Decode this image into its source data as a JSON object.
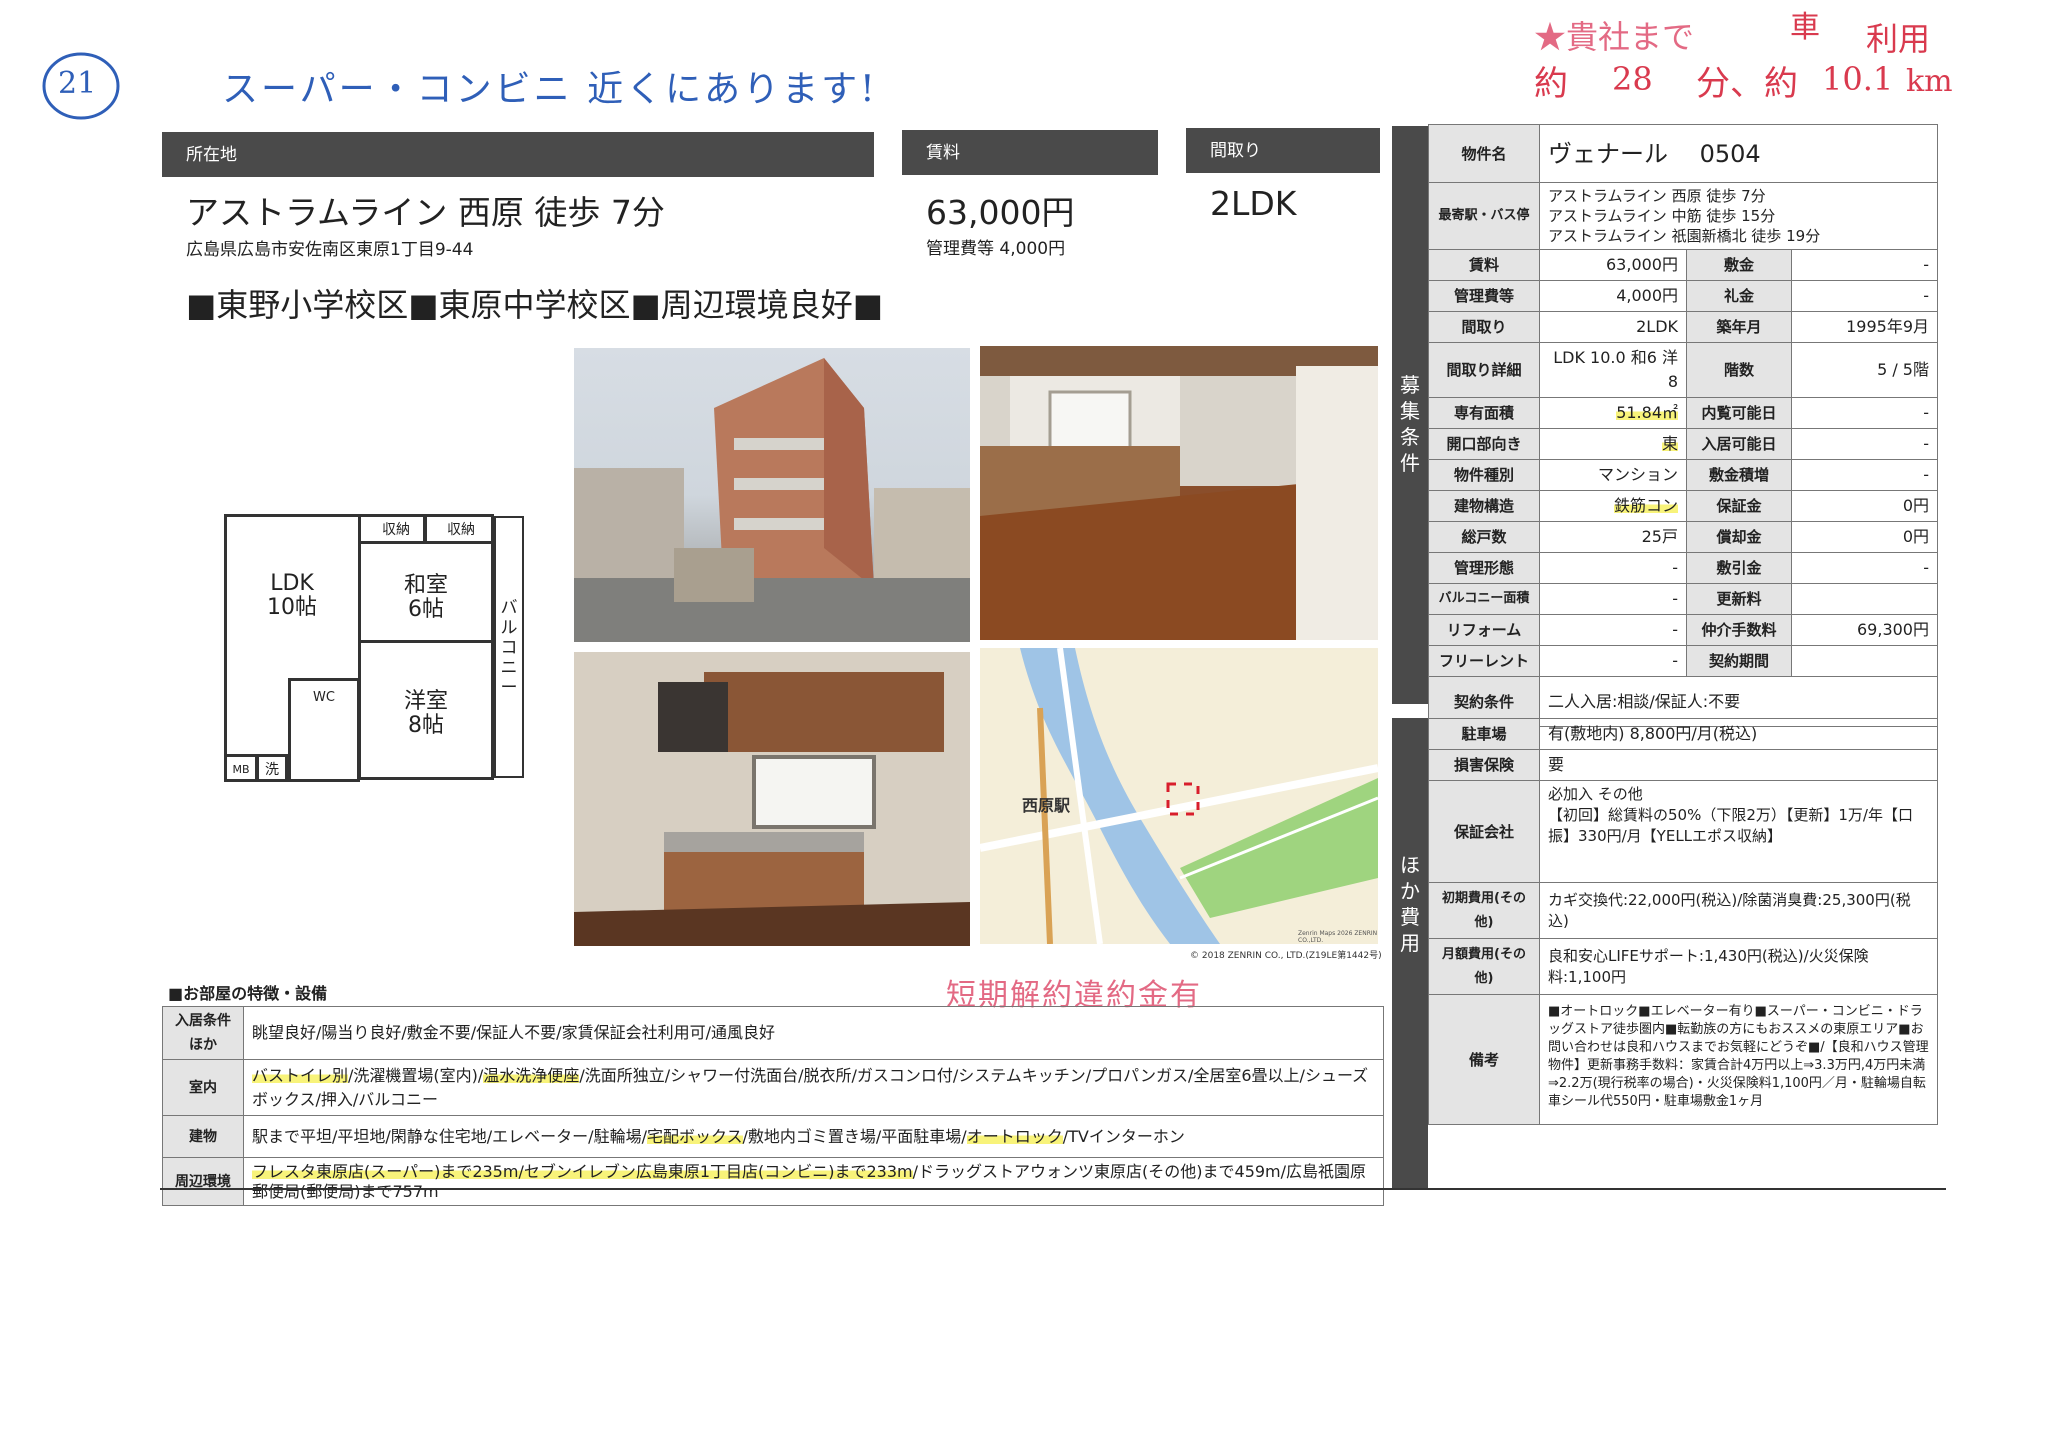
{
  "handwritten": {
    "circle_number": "21",
    "note": "スーパー・コンビニ 近くにあります!",
    "commute_line1_a": "★貴社まで",
    "commute_line1_b": "車",
    "commute_line1_c": "利用",
    "commute_approx1": "約",
    "commute_minutes": "28",
    "commute_min_unit": "分、約",
    "commute_km": "10.1",
    "commute_km_unit": "km",
    "penalty_stamp": "短期解約違約金有",
    "colors": {
      "blue": "#2f5fb8",
      "red": "#d93a4e",
      "pink": "#e36a84"
    }
  },
  "header": {
    "location_label": "所在地",
    "rent_label": "賃料",
    "layout_label": "間取り"
  },
  "summary": {
    "access": "アストラムライン 西原 徒歩 7分",
    "address": "広島県広島市安佐南区東原1丁目9-44",
    "rent": "63,000円",
    "mgmt": "管理費等 4,000円",
    "layout": "2LDK",
    "school": "■東野小学校区■東原中学校区■周辺環境良好■"
  },
  "floorplan": {
    "storage1": "収納",
    "storage2": "収納",
    "ldk": "LDK",
    "ldk_size": "10帖",
    "washitsu": "和室",
    "washitsu_size": "6帖",
    "youshitsu": "洋室",
    "youshitsu_size": "8帖",
    "balcony": "バルコニー",
    "wc": "WC",
    "mb": "MB",
    "wash": "洗"
  },
  "map": {
    "station": "西原駅",
    "copyright_small": "Zenrin Maps 2026 ZENRIN CO.,LTD.",
    "copyright": "© 2018 ZENRIN CO., LTD.(Z19LE第1442号)"
  },
  "recruit_label": "募集条件",
  "other_label": "ほか費用",
  "specs": {
    "name_label": "物件名",
    "name": "ヴェナール　 0504",
    "station_label": "最寄駅・バス停",
    "station1": "アストラムライン 西原 徒歩 7分",
    "station2": "アストラムライン 中筋 徒歩 15分",
    "station3": "アストラムライン 祇園新橋北 徒歩 19分",
    "rows": [
      {
        "l1": "賃料",
        "v1": "63,000円",
        "l2": "敷金",
        "v2": "-"
      },
      {
        "l1": "管理費等",
        "v1": "4,000円",
        "l2": "礼金",
        "v2": "-"
      },
      {
        "l1": "間取り",
        "v1": "2LDK",
        "l2": "築年月",
        "v2": "1995年9月"
      },
      {
        "l1": "間取り詳細",
        "v1": "LDK 10.0 和6 洋8",
        "l2": "階数",
        "v2": "5 / 5階"
      },
      {
        "l1": "専有面積",
        "v1": "51.84㎡",
        "l2": "内覧可能日",
        "v2": "-"
      },
      {
        "l1": "開口部向き",
        "v1": "東",
        "l2": "入居可能日",
        "v2": "-"
      },
      {
        "l1": "物件種別",
        "v1": "マンション",
        "l2": "敷金積増",
        "v2": "-"
      },
      {
        "l1": "建物構造",
        "v1": "鉄筋コン",
        "l2": "保証金",
        "v2": "0円"
      },
      {
        "l1": "総戸数",
        "v1": "25戸",
        "l2": "償却金",
        "v2": "0円"
      },
      {
        "l1": "管理形態",
        "v1": "-",
        "l2": "敷引金",
        "v2": "-"
      },
      {
        "l1": "バルコニー面積",
        "v1": "-",
        "l2": "更新料",
        "v2": ""
      },
      {
        "l1": "リフォーム",
        "v1": "-",
        "l2": "仲介手数料",
        "v2": "69,300円"
      },
      {
        "l1": "フリーレント",
        "v1": "-",
        "l2": "契約期間",
        "v2": ""
      }
    ],
    "contract_label": "契約条件",
    "contract": "二人入居:相談/保証人:不要"
  },
  "costs": {
    "parking_label": "駐車場",
    "parking": "有(敷地内) 8,800円/月(税込)",
    "insurance_label": "損害保険",
    "insurance": "要",
    "guarantor_label": "保証会社",
    "guarantor": "必加入 その他\n【初回】総賃料の50%（下限2万）【更新】1万/年【口振】330円/月【YELLエポス収納】",
    "initial_label": "初期費用(その他)",
    "initial": "カギ交換代:22,000円(税込)/除菌消臭費:25,300円(税込)",
    "monthly_label": "月額費用(その他)",
    "monthly": "良和安心LIFEサポート:1,430円(税込)/火災保険料:1,100円",
    "notes_label": "備考",
    "notes": "■オートロック■エレベーター有り■スーパー・コンビニ・ドラッグストア徒歩圏内■転勤族の方にもおススメの東原エリア■お問い合わせは良和ハウスまでお気軽にどうぞ■/【良和ハウス管理物件】更新事務手数料：家賃合計4万円以上⇒3.3万円,4万円未満⇒2.2万(現行税率の場合)・火災保険料1,100円／月・駐輪場自転車シール代550円・駐車場敷金1ヶ月"
  },
  "features": {
    "title": "■お部屋の特徴・設備",
    "row1_label": "入居条件ほか",
    "row1": "眺望良好/陽当り良好/敷金不要/保証人不要/家賃保証会社利用可/通風良好",
    "row2_label": "室内",
    "row2_hl1": "バストイレ別",
    "row2_a": "/洗濯機置場(室内)/",
    "row2_hl2": "温水洗浄便座",
    "row2_b": "/洗面所独立/シャワー付洗面台/脱衣所/ガスコンロ付/システムキッチン/プロパンガス/全居室6畳以上/シューズボックス/押入/バルコニー",
    "row3_label": "建物",
    "row3_a": "駅まで平坦/平坦地/閑静な住宅地/エレベーター/駐輪場/",
    "row3_hl1": "宅配ボックス",
    "row3_b": "/敷地内ゴミ置き場/平面駐車場/",
    "row3_hl2": "オートロック",
    "row3_c": "/TVインターホン",
    "row4_label": "周辺環境",
    "row4_hl": "フレスタ東原店(スーパー)まで235m/セブンイレブン広島東原1丁目店(コンビニ)まで233m",
    "row4_a": "/ドラッグストアウォンツ東原店(その他)まで459m/広島祇園原郵便局(郵便局)まで757m"
  }
}
